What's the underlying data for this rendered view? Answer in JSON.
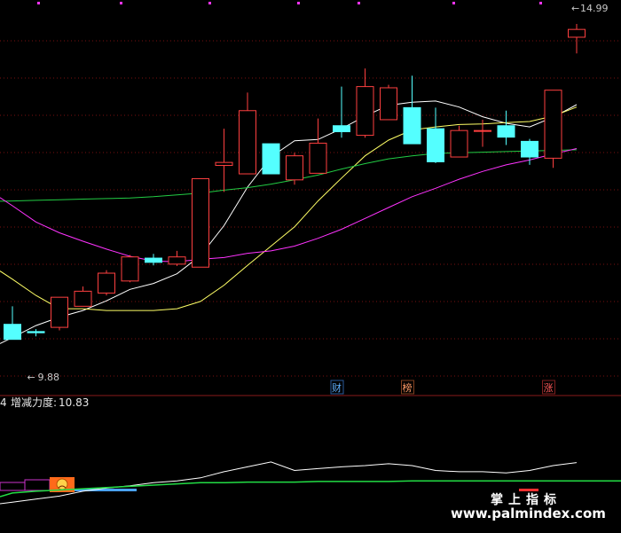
{
  "chart_data": {
    "type": "candlestick",
    "price_range": [
      9.2,
      15.3
    ],
    "candles": [
      {
        "o": 10.0,
        "h": 10.3,
        "l": 9.95,
        "c": 9.75
      },
      {
        "o": 9.88,
        "h": 9.92,
        "l": 9.8,
        "c": 9.86
      },
      {
        "o": 9.95,
        "h": 10.45,
        "l": 9.9,
        "c": 10.45
      },
      {
        "o": 10.3,
        "h": 10.63,
        "l": 10.3,
        "c": 10.55
      },
      {
        "o": 10.52,
        "h": 10.9,
        "l": 10.48,
        "c": 10.85
      },
      {
        "o": 10.72,
        "h": 11.15,
        "l": 10.7,
        "c": 11.12
      },
      {
        "o": 11.1,
        "h": 11.17,
        "l": 10.98,
        "c": 11.03
      },
      {
        "o": 11.0,
        "h": 11.22,
        "l": 10.97,
        "c": 11.12
      },
      {
        "o": 10.95,
        "h": 12.42,
        "l": 10.95,
        "c": 12.42
      },
      {
        "o": 12.64,
        "h": 13.25,
        "l": 12.2,
        "c": 12.69
      },
      {
        "o": 12.5,
        "h": 13.85,
        "l": 12.5,
        "c": 13.55
      },
      {
        "o": 13.0,
        "h": 13.0,
        "l": 12.5,
        "c": 12.5
      },
      {
        "o": 12.4,
        "h": 12.85,
        "l": 12.32,
        "c": 12.8
      },
      {
        "o": 12.51,
        "h": 13.42,
        "l": 12.51,
        "c": 13.01
      },
      {
        "o": 13.3,
        "h": 13.95,
        "l": 13.1,
        "c": 13.2
      },
      {
        "o": 13.14,
        "h": 14.25,
        "l": 13.1,
        "c": 13.95
      },
      {
        "o": 13.4,
        "h": 13.98,
        "l": 13.4,
        "c": 13.93
      },
      {
        "o": 13.6,
        "h": 14.13,
        "l": 13.1,
        "c": 13.0
      },
      {
        "o": 13.25,
        "h": 13.6,
        "l": 12.68,
        "c": 12.7
      },
      {
        "o": 12.78,
        "h": 13.3,
        "l": 12.78,
        "c": 13.22
      },
      {
        "o": 13.22,
        "h": 13.4,
        "l": 12.95,
        "c": 13.22
      },
      {
        "o": 13.3,
        "h": 13.55,
        "l": 12.98,
        "c": 13.11
      },
      {
        "o": 13.04,
        "h": 13.08,
        "l": 12.65,
        "c": 12.78
      },
      {
        "o": 12.76,
        "h": 13.89,
        "l": 12.6,
        "c": 13.89
      },
      {
        "o": 14.77,
        "h": 14.99,
        "l": 14.5,
        "c": 14.9
      }
    ],
    "ma_lines": [
      {
        "color": "#ffffff",
        "values": [
          9.78,
          9.98,
          10.12,
          10.23,
          10.39,
          10.58,
          10.68,
          10.84,
          11.14,
          11.64,
          12.28,
          12.78,
          13.05,
          13.07,
          13.25,
          13.46,
          13.64,
          13.69,
          13.71,
          13.61,
          13.45,
          13.34,
          13.28,
          13.44,
          13.65
        ]
      },
      {
        "color": "#ffff66",
        "values": [
          10.75,
          10.48,
          10.26,
          10.26,
          10.23,
          10.23,
          10.23,
          10.26,
          10.38,
          10.65,
          10.98,
          11.3,
          11.62,
          12.05,
          12.43,
          12.8,
          13.06,
          13.23,
          13.28,
          13.32,
          13.33,
          13.35,
          13.37,
          13.46,
          13.61
        ]
      },
      {
        "color": "#22cc44",
        "values": [
          12.05,
          12.06,
          12.07,
          12.08,
          12.09,
          12.1,
          12.12,
          12.15,
          12.18,
          12.23,
          12.27,
          12.33,
          12.4,
          12.48,
          12.58,
          12.67,
          12.75,
          12.8,
          12.84,
          12.85,
          12.86,
          12.87,
          12.88,
          12.89,
          12.9
        ]
      },
      {
        "color": "#ff33ff",
        "values": [
          11.97,
          11.7,
          11.52,
          11.38,
          11.25,
          11.13,
          11.05,
          11.04,
          11.08,
          11.11,
          11.18,
          11.22,
          11.3,
          11.43,
          11.58,
          11.76,
          11.94,
          12.12,
          12.26,
          12.41,
          12.54,
          12.65,
          12.73,
          12.83,
          12.92
        ]
      }
    ],
    "annotations": {
      "low_label": "9.88",
      "high_label": "14.99",
      "low_arrow": "←",
      "high_arrow": "←"
    },
    "event_tags": [
      {
        "index": 14,
        "text": "财",
        "color": "#5fb0ff",
        "border": "#2a5a9a"
      },
      {
        "index": 17,
        "text": "榜",
        "color": "#ff9a66",
        "border": "#804020"
      },
      {
        "index": 23,
        "text": "涨",
        "color": "#ff5a5a",
        "border": "#802020"
      }
    ],
    "indicator": {
      "label_prefix": "4",
      "name": "增减力度:",
      "value": "10.83",
      "white_values": [
        0.2,
        0.25,
        0.3,
        0.38,
        0.43,
        0.47,
        0.52,
        0.55,
        0.6,
        0.7,
        0.78,
        0.86,
        0.72,
        0.75,
        0.78,
        0.8,
        0.83,
        0.8,
        0.72,
        0.7,
        0.7,
        0.68,
        0.72,
        0.8,
        0.85
      ],
      "green_values": [
        0.35,
        0.38,
        0.4,
        0.42,
        0.44,
        0.46,
        0.48,
        0.5,
        0.52,
        0.52,
        0.53,
        0.53,
        0.53,
        0.54,
        0.54,
        0.54,
        0.54,
        0.55,
        0.55,
        0.55,
        0.55,
        0.55,
        0.55,
        0.55,
        0.55
      ],
      "range": [
        0,
        1.6
      ]
    },
    "watermark": {
      "top": "掌上指标",
      "bottom": "www.palmindex.com"
    },
    "colors": {
      "up": "#ff4040",
      "down": "#54ffff",
      "grid": "#7a1010",
      "divider": "#8a1a1a"
    }
  }
}
